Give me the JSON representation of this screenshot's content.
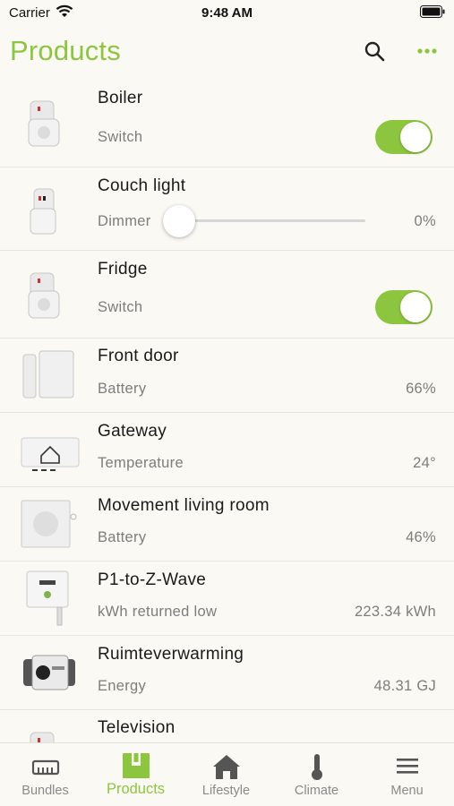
{
  "status_bar": {
    "carrier": "Carrier",
    "time": "9:48 AM"
  },
  "header": {
    "title": "Products"
  },
  "colors": {
    "accent": "#8cc63f",
    "background": "#fbf9f3",
    "secondary_text": "#7d7d7d"
  },
  "products": [
    {
      "name": "Boiler",
      "property": "Switch",
      "control": "toggle",
      "on": true,
      "icon": "plug-switch-icon"
    },
    {
      "name": "Couch light",
      "property": "Dimmer",
      "control": "slider",
      "level": 0,
      "value": "0%",
      "icon": "dimmer-plug-icon"
    },
    {
      "name": "Fridge",
      "property": "Switch",
      "control": "toggle",
      "on": true,
      "icon": "plug-switch-icon"
    },
    {
      "name": "Front door",
      "property": "Battery",
      "value": "66%",
      "icon": "door-sensor-icon"
    },
    {
      "name": "Gateway",
      "property": "Temperature",
      "value": "24°",
      "icon": "gateway-icon"
    },
    {
      "name": "Movement living room",
      "property": "Battery",
      "value": "46%",
      "icon": "motion-sensor-icon"
    },
    {
      "name": "P1-to-Z-Wave",
      "property": "kWh returned low",
      "value": "223.34 kWh",
      "icon": "p1-dongle-icon"
    },
    {
      "name": "Ruimteverwarming",
      "property": "Energy",
      "value": "48.31 GJ",
      "icon": "heat-meter-icon"
    },
    {
      "name": "Television",
      "icon": "plug-switch-icon"
    }
  ],
  "tabs": [
    {
      "label": "Bundles",
      "icon": "bundles-icon",
      "active": false
    },
    {
      "label": "Products",
      "icon": "products-icon",
      "active": true
    },
    {
      "label": "Lifestyle",
      "icon": "house-icon",
      "active": false
    },
    {
      "label": "Climate",
      "icon": "thermometer-icon",
      "active": false
    },
    {
      "label": "Menu",
      "icon": "hamburger-icon",
      "active": false
    }
  ]
}
